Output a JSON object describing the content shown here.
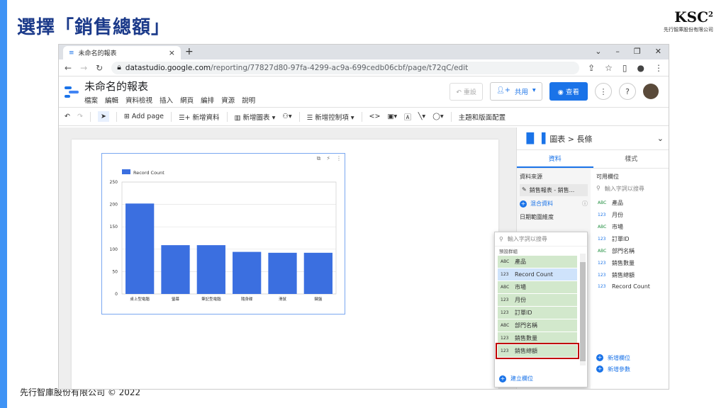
{
  "slide": {
    "title": "選擇「銷售總額」",
    "logo_text": "KSC",
    "logo_sup": "2",
    "logo_sub": "先行智庫股份有限公司",
    "footer": "先行智庫股份有限公司 © 2022"
  },
  "browser": {
    "tab_title": "未命名的報表",
    "tab_close": "×",
    "new_tab": "+",
    "url_domain": "datastudio.google.com",
    "url_path": "/reporting/77827d80-97fa-4299-ac9a-699cedb06cbf/page/t72qC/edit"
  },
  "report": {
    "title": "未命名的報表",
    "menu": [
      "檔案",
      "編輯",
      "資料檢視",
      "插入",
      "網頁",
      "編排",
      "資源",
      "說明"
    ],
    "reset_label": "重設",
    "share_label": "共用",
    "view_label": "查看"
  },
  "toolbar": {
    "add_page": "Add page",
    "add_data": "新增資料",
    "add_chart": "新增圖表",
    "add_control": "新增控制項",
    "theme": "主題和版面配置"
  },
  "chart_data": {
    "type": "bar",
    "legend": "Record Count",
    "categories": [
      "桌上型電腦",
      "螢幕",
      "筆記型電腦",
      "隨身碟",
      "滑鼠",
      "鍵盤"
    ],
    "values": [
      202,
      109,
      109,
      94,
      92,
      92
    ],
    "ylim": [
      0,
      250
    ],
    "yticks": [
      0,
      50,
      100,
      150,
      200,
      250
    ],
    "grid": true,
    "bar_color": "#3b6fe0"
  },
  "panel": {
    "breadcrumb": "圖表 > 長條",
    "tab_data": "資料",
    "tab_style": "樣式",
    "data_source_label": "資料來源",
    "data_source": "銷售報表 - 銷售...",
    "blend": "混合資料",
    "date_dim": "日期範圍維度",
    "available_fields": "可用欄位",
    "search_placeholder": "輸入字詞以搜尋",
    "fields": [
      {
        "type": "ABC",
        "name": "產品"
      },
      {
        "type": "123",
        "name": "月份"
      },
      {
        "type": "ABC",
        "name": "市場"
      },
      {
        "type": "123",
        "name": "訂單ID"
      },
      {
        "type": "ABC",
        "name": "部門名稱"
      },
      {
        "type": "123",
        "name": "銷售數量"
      },
      {
        "type": "123",
        "name": "銷售總額"
      },
      {
        "type": "123",
        "name": "Record Count"
      }
    ],
    "add_field": "新增欄位",
    "add_param": "新增參數"
  },
  "dropdown": {
    "search_placeholder": "輸入字詞以搜尋",
    "group": "預設群組",
    "items": [
      {
        "type": "ABC",
        "name": "產品"
      },
      {
        "type": "123",
        "name": "Record Count"
      },
      {
        "type": "ABC",
        "name": "市場"
      },
      {
        "type": "123",
        "name": "月份"
      },
      {
        "type": "123",
        "name": "訂單ID"
      },
      {
        "type": "ABC",
        "name": "部門名稱"
      },
      {
        "type": "123",
        "name": "銷售數量"
      },
      {
        "type": "123",
        "name": "銷售總額"
      }
    ],
    "create_field": "建立欄位"
  }
}
